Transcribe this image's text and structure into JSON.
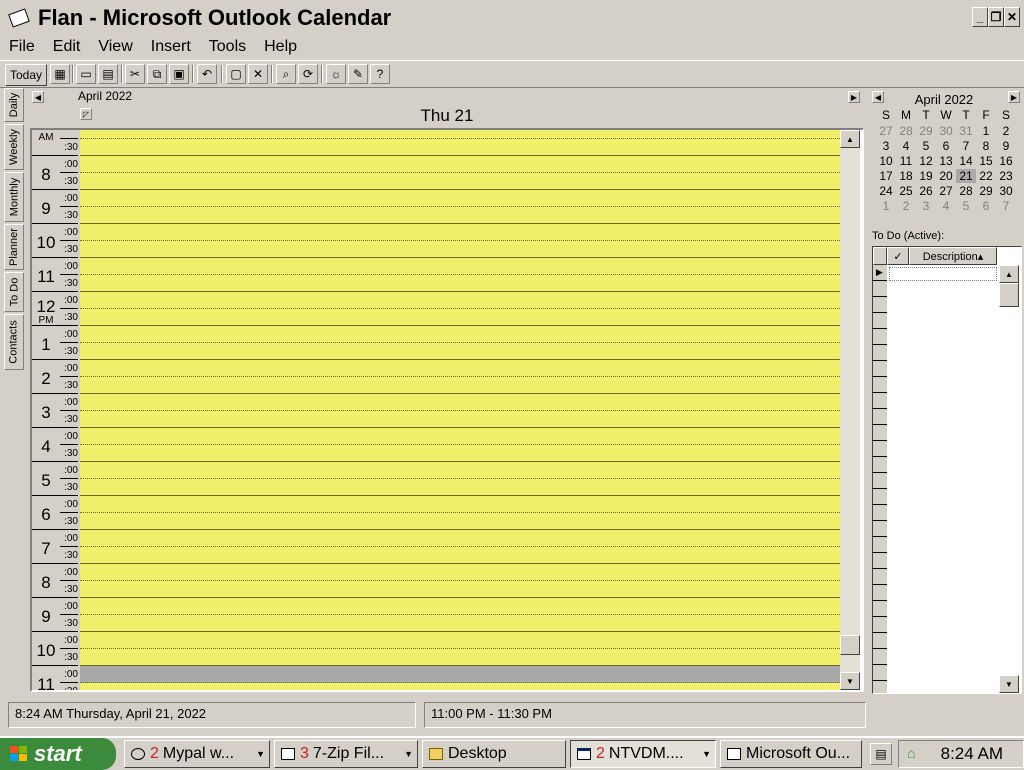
{
  "window": {
    "title": "Flan - Microsoft Outlook Calendar",
    "minimize": "_",
    "restore": "❐",
    "close": "✕"
  },
  "menu": [
    "File",
    "Edit",
    "View",
    "Insert",
    "Tools",
    "Help"
  ],
  "toolbar": {
    "today_label": "Today",
    "icons": [
      "goto-date-icon",
      "open-icon",
      "print-icon",
      "cut-icon",
      "copy-icon",
      "paste-icon",
      "undo-icon",
      "new-appointment-icon",
      "delete-icon",
      "find-icon",
      "refresh-icon",
      "reminder-icon",
      "edit-icon",
      "help-icon"
    ]
  },
  "view_tabs": [
    "Daily",
    "Weekly",
    "Monthly",
    "Planner",
    "To Do",
    "Contacts"
  ],
  "calendar": {
    "month_label": "April 2022",
    "day_label": "Thu 21",
    "hours": [
      {
        "num": "",
        "ampm": "AM"
      },
      {
        "num": "8",
        "ampm": ""
      },
      {
        "num": "9",
        "ampm": ""
      },
      {
        "num": "10",
        "ampm": ""
      },
      {
        "num": "11",
        "ampm": ""
      },
      {
        "num": "12",
        "ampm": "PM"
      },
      {
        "num": "1",
        "ampm": ""
      },
      {
        "num": "2",
        "ampm": ""
      },
      {
        "num": "3",
        "ampm": ""
      },
      {
        "num": "4",
        "ampm": ""
      },
      {
        "num": "5",
        "ampm": ""
      },
      {
        "num": "6",
        "ampm": ""
      },
      {
        "num": "7",
        "ampm": ""
      },
      {
        "num": "8",
        "ampm": ""
      },
      {
        "num": "9",
        "ampm": ""
      },
      {
        "num": "10",
        "ampm": ""
      },
      {
        "num": "11",
        "ampm": ""
      }
    ],
    "min_00": ":00",
    "min_30": ":30",
    "slot_color": "#f1ee6a",
    "selected_slot_color": "#a9a9a9"
  },
  "mini_calendar": {
    "title": "April 2022",
    "weekdays": [
      "S",
      "M",
      "T",
      "W",
      "T",
      "F",
      "S"
    ],
    "weeks": [
      [
        "27",
        "28",
        "29",
        "30",
        "31",
        "1",
        "2"
      ],
      [
        "3",
        "4",
        "5",
        "6",
        "7",
        "8",
        "9"
      ],
      [
        "10",
        "11",
        "12",
        "13",
        "14",
        "15",
        "16"
      ],
      [
        "17",
        "18",
        "19",
        "20",
        "21",
        "22",
        "23"
      ],
      [
        "24",
        "25",
        "26",
        "27",
        "28",
        "29",
        "30"
      ],
      [
        "1",
        "2",
        "3",
        "4",
        "5",
        "6",
        "7"
      ]
    ],
    "selected": "21"
  },
  "todo": {
    "label": "To Do (Active):",
    "check_header": "✓",
    "description_header": "Description▴"
  },
  "status": {
    "datetime": "8:24 AM Thursday, April 21, 2022",
    "selection": "11:00 PM - 11:30 PM"
  },
  "taskbar": {
    "start_label": "start",
    "buttons": [
      {
        "count": "2",
        "label": "Mypal w...",
        "icon": "browser-icon"
      },
      {
        "count": "3",
        "label": "7-Zip Fil...",
        "icon": "archive-icon"
      },
      {
        "count": "",
        "label": "Desktop",
        "icon": "folder-icon"
      },
      {
        "count": "2",
        "label": "NTVDM....",
        "icon": "window-icon"
      },
      {
        "count": "",
        "label": "Microsoft Ou...",
        "icon": "calendar-icon"
      }
    ],
    "clock": "8:24 AM"
  }
}
